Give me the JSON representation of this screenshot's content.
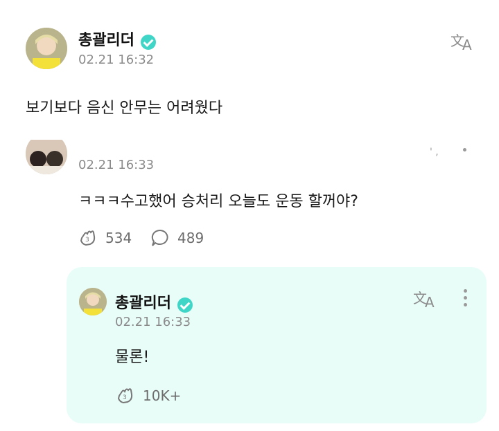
{
  "post": {
    "author": "총괄리더",
    "timestamp": "02.21 16:32",
    "text": "보기보다 음신 안무는 어려웠다"
  },
  "comment": {
    "timestamp": "02.21 16:33",
    "text": "ㅋㅋㅋ수고했어 승처리 오늘도 운동 할꺼야?",
    "likes": "534",
    "replies": "489"
  },
  "reply": {
    "author": "총괄리더",
    "timestamp": "02.21 16:33",
    "text": "물론!",
    "likes": "10K+"
  },
  "icons": {
    "translate": "translate-icon",
    "verified": "verified-badge-icon",
    "like": "cheer-hand-icon",
    "comment": "speech-bubble-icon",
    "more": "more-vertical-icon"
  },
  "colors": {
    "verified": "#3fd6c7",
    "reply_bg": "#e9fdf8"
  }
}
